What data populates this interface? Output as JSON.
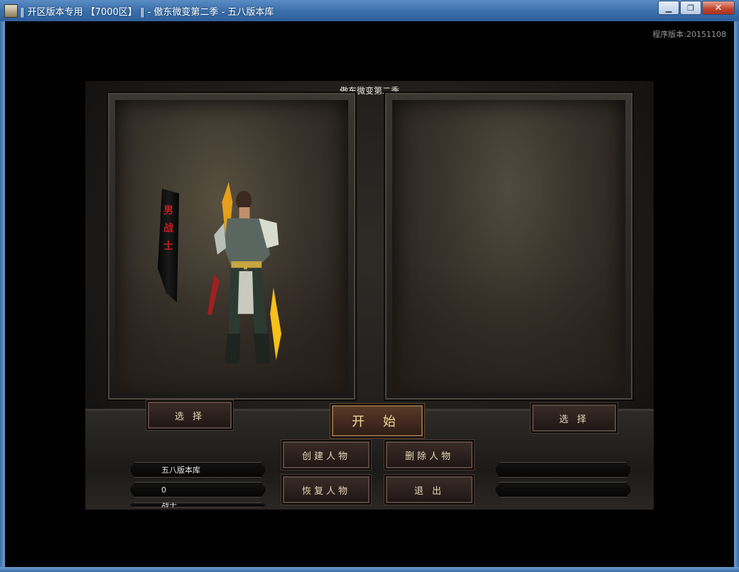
{
  "window": {
    "title": "‖ 开区版本专用 【7000区】 ‖ - 傲东微变第二季 - 五八版本库",
    "minimize": "▁",
    "restore": "❐",
    "close": "✕"
  },
  "client": {
    "version_text": "程序版本:20151108"
  },
  "game": {
    "title": "傲东微变第二季",
    "char_class_banner": "男战士",
    "buttons": {
      "select_left": "选 择",
      "select_right": "选 择",
      "start": "开 始",
      "create_char": "创建人物",
      "delete_char": "删除人物",
      "restore_char": "恢复人物",
      "exit": "退 出"
    },
    "left_info": {
      "name": "五八版本库",
      "level": "0",
      "job": "战士"
    },
    "right_info": {
      "name": "",
      "level": "",
      "job": ""
    }
  }
}
